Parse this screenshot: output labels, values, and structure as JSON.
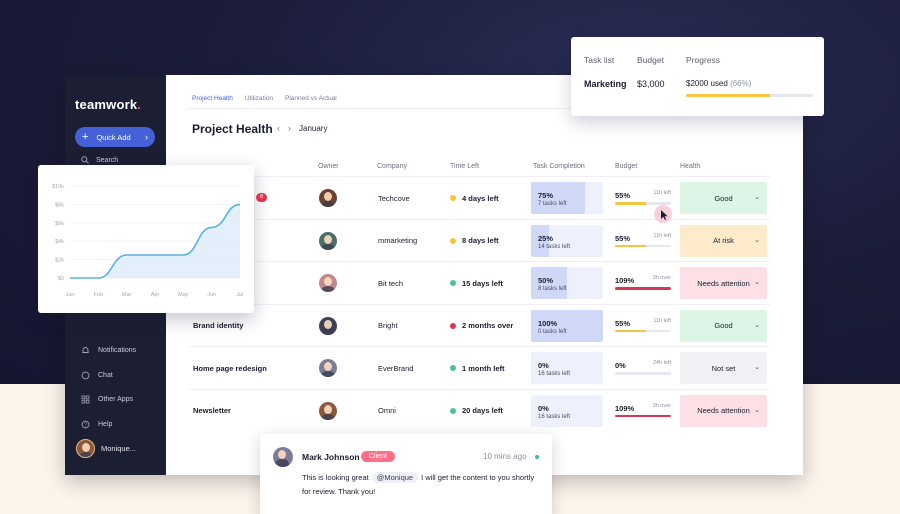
{
  "sidebar": {
    "logo": "teamwork",
    "logo_dot": ".",
    "quick_add": "Quick Add",
    "search": "Search",
    "items": [
      {
        "label": "Notifications",
        "icon": "bell-icon"
      },
      {
        "label": "Chat",
        "icon": "chat-icon"
      },
      {
        "label": "Other Apps",
        "icon": "apps-grid-icon"
      },
      {
        "label": "Help",
        "icon": "help-icon"
      }
    ],
    "user": "Monique..."
  },
  "tabs": [
    "Project Health",
    "Utilization",
    "Planned vs Actual"
  ],
  "page": {
    "title": "Project Health",
    "month": "January",
    "prev_icon": "chevron-left-icon",
    "next_icon": "chevron-right-icon"
  },
  "table": {
    "headers": [
      "Owner",
      "Company",
      "Time Left",
      "Task Completion",
      "Budget",
      "Health"
    ],
    "rows": [
      {
        "name": "",
        "company": "Techcove",
        "time_left": "4 days left",
        "time_color": "#f4c542",
        "completion_pct": "75%",
        "completion": 0.75,
        "tasks_left": "7 tasks left",
        "budget_pct": "55%",
        "budget": 0.55,
        "budget_color": "#f4c542",
        "budget_left": "11h left",
        "health": "Good",
        "health_bg": "#dcf5e6",
        "avatar_color": "#6b4330"
      },
      {
        "name": "",
        "company": "mmarketing",
        "time_left": "8 days left",
        "time_color": "#f4c542",
        "completion_pct": "25%",
        "completion": 0.25,
        "tasks_left": "14 tasks left",
        "budget_pct": "55%",
        "budget": 0.55,
        "budget_color": "#f4c542",
        "budget_left": "11h left",
        "health": "At risk",
        "health_bg": "#fdebcb",
        "avatar_color": "#4a6f67"
      },
      {
        "name": "",
        "company": "Bit tech",
        "time_left": "15 days left",
        "time_color": "#4fbf9a",
        "completion_pct": "50%",
        "completion": 0.5,
        "tasks_left": "8 tasks left",
        "budget_pct": "109%",
        "budget": 1.0,
        "budget_color": "#d93650",
        "budget_left": "3h over",
        "health": "Needs attention",
        "health_bg": "#fde0e5",
        "avatar_color": "#c08a8e"
      },
      {
        "name": "Brand identity",
        "company": "Bright",
        "time_left": "2 months over",
        "time_color": "#d93650",
        "completion_pct": "100%",
        "completion": 1.0,
        "tasks_left": "0 tasks left",
        "budget_pct": "55%",
        "budget": 0.55,
        "budget_color": "#f4c542",
        "budget_left": "11h left",
        "health": "Good",
        "health_bg": "#dcf5e6",
        "avatar_color": "#3e4258"
      },
      {
        "name": "Home page redesign",
        "company": "EverBrand",
        "time_left": "1 month left",
        "time_color": "#4fbf9a",
        "completion_pct": "0%",
        "completion": 0.0,
        "tasks_left": "16 tasks left",
        "budget_pct": "0%",
        "budget": 0.0,
        "budget_color": "#f4c542",
        "budget_left": "24h left",
        "health": "Not set",
        "health_bg": "#f1f2f6",
        "avatar_color": "#7b7d98"
      },
      {
        "name": "Newsletter",
        "company": "Omni",
        "time_left": "20 days left",
        "time_color": "#4fbf9a",
        "completion_pct": "0%",
        "completion": 0.0,
        "tasks_left": "16 tasks left",
        "budget_pct": "109%",
        "budget": 1.0,
        "budget_color": "#d93650",
        "budget_left": "3h over",
        "health": "Needs attention",
        "health_bg": "#fde0e5",
        "avatar_color": "#8a5a3c"
      }
    ],
    "badge": "8"
  },
  "chart_data": {
    "type": "line",
    "x": [
      "Jan",
      "Feb",
      "Mar",
      "Apr",
      "May",
      "Jun",
      "Jul"
    ],
    "y_ticks": [
      "$0",
      "$2k",
      "$4k",
      "$6k",
      "$8k",
      "$10k"
    ],
    "ylim": [
      0,
      10000
    ],
    "series": [
      {
        "values": [
          0,
          0,
          2500,
          2500,
          2500,
          5500,
          8000
        ]
      }
    ],
    "grid": true,
    "line_color": "#5ab0e4",
    "fill_color": "#dcecfa"
  },
  "task_tooltip": {
    "headers": [
      "Task list",
      "Budget",
      "Progress"
    ],
    "name": "Marketing",
    "budget": "$3,000",
    "used": "$2000 used",
    "used_pct": "(66%)",
    "progress": 0.66
  },
  "comment": {
    "author": "Mark Johnson",
    "role": "Client",
    "time": "10 mins ago",
    "text_before": "This is looking great",
    "mention": "@Monique",
    "text_after": "I will get the content to you shortly for review. Thank you!"
  }
}
